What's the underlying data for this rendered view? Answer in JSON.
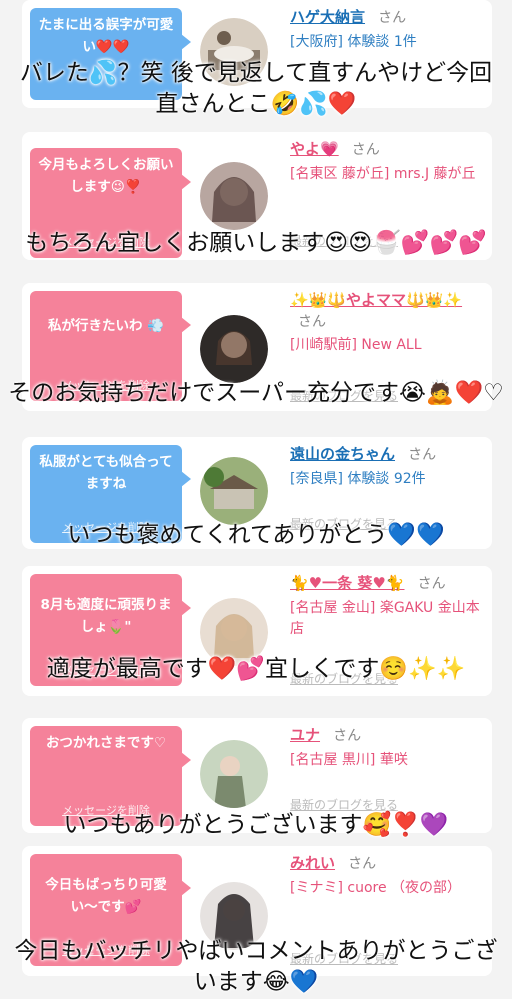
{
  "common": {
    "delete_label": "メッセージを削除",
    "blog_label": "最新のブログを見る",
    "san_label": "さん"
  },
  "cards": [
    {
      "message": "たまに出る誤字が可愛い❤️❤️",
      "name": "ハゲ大納言",
      "shop": "[大阪府] 体験談 1件",
      "caption": "バレた💦？笑 後で見返して直すんやけど今回直さんとこ🤣💦❤️"
    },
    {
      "message": "今月もよろしくお願いします😉❣️",
      "name": "やよ💗",
      "shop": "[名東区 藤が丘] mrs.J 藤が丘",
      "caption": "もちろん宜しくお願いします😍😍🍧💕💕💕"
    },
    {
      "message": "私が行きたいわ 💨",
      "name": "✨👑🔱やよママ🔱👑✨",
      "shop": "[川崎駅前] New ALL",
      "caption": "そのお気持ちだけでスーパー充分です😭🙇❤️♡"
    },
    {
      "message": "私服がとても似合ってますね",
      "name": "遠山の金ちゃん",
      "shop": "[奈良県] 体験談 92件",
      "caption": "いつも褒めてくれてありがとう💙💙"
    },
    {
      "message": "8月も適度に頑張りましょ🌷\"",
      "name": "🐈♥一条 葵♥🐈",
      "shop": "[名古屋 金山] 楽GAKU 金山本店",
      "caption": "適度が最高です❤️💕宜しくです☺️✨✨"
    },
    {
      "message": "おつかれさまです♡",
      "name": "ユナ",
      "shop": "[名古屋 黒川] 華咲",
      "caption": "いつもありがとうございます🥰❣️💜"
    },
    {
      "message": "今日もばっちり可愛い〜です💕",
      "name": "みれい",
      "shop": "[ミナミ] cuore （夜の部）",
      "caption": "今日もバッチリやばいコメントありがとうございます😂💙"
    }
  ],
  "colors": {
    "bubble_pink": "#f5829a",
    "bubble_blue": "#6ab2f0",
    "name_blue": "#1a6fb5",
    "name_pink": "#e6527a",
    "background": "#f3f3f3"
  },
  "icons": {
    "avatar": "profile-avatar-image"
  }
}
